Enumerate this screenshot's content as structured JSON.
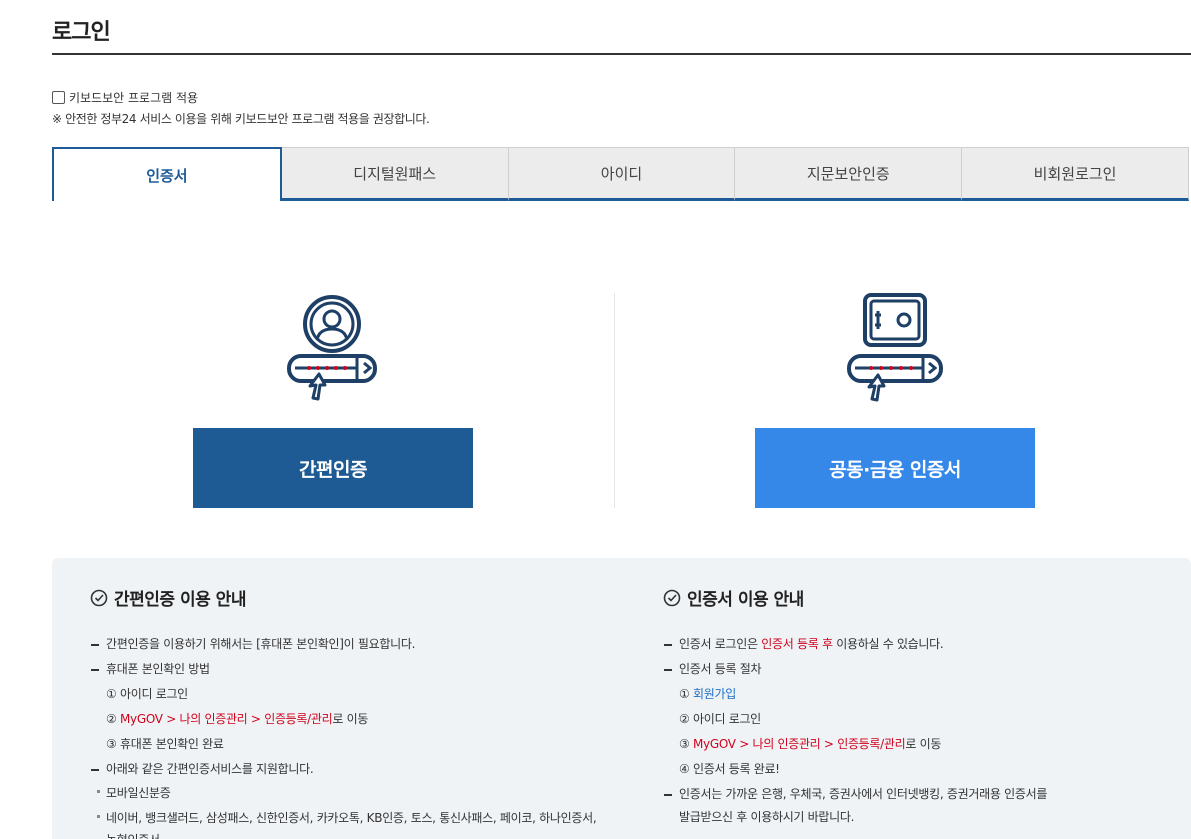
{
  "header": {
    "title": "로그인"
  },
  "keyboard_security": {
    "label": "키보드보안 프로그램 적용",
    "note": "※ 안전한 정부24 서비스 이용을 위해 키보드보안 프로그램 적용을 권장합니다."
  },
  "tabs": [
    {
      "label": "인증서",
      "active": true
    },
    {
      "label": "디지털원패스",
      "active": false
    },
    {
      "label": "아이디",
      "active": false
    },
    {
      "label": "지문보안인증",
      "active": false
    },
    {
      "label": "비회원로그인",
      "active": false
    }
  ],
  "login_options": {
    "simple_auth_button": "간편인증",
    "cert_button": "공동·금융 인증서"
  },
  "icons": {
    "simple_auth": "user-password-icon",
    "cert": "safe-password-icon",
    "check": "check-circle-icon"
  },
  "colors": {
    "accent": "#1e5b94",
    "cert_button": "#3587e8",
    "highlight": "#d0021b",
    "link": "#1e6fc6"
  },
  "simple_auth_guide": {
    "title": "간편인증 이용 안내",
    "item1": "간편인증을 이용하기 위해서는 [휴대폰 본인확인]이 필요합니다.",
    "item2": "휴대폰 본인확인 방법",
    "step1": "① 아이디 로그인",
    "step2_prefix": "② ",
    "step2_path": "MyGOV > 나의 인증관리 > 인증등록/관리",
    "step2_suffix": "로 이동",
    "step3": "③ 휴대폰 본인확인 완료",
    "item3": "아래와 같은 간편인증서비스를 지원합니다.",
    "service1": "모바일신분증",
    "service2": "네이버, 뱅크샐러드, 삼성패스, 신한인증서, 카카오톡, KB인증, 토스, 통신사패스, 페이코, 하나인증서,",
    "service2b": "농협인증서"
  },
  "cert_guide": {
    "title": "인증서 이용 안내",
    "item1_prefix": "인증서 로그인은 ",
    "item1_highlight": "인증서 등록 후",
    "item1_suffix": " 이용하실 수 있습니다.",
    "item2": "인증서 등록 절차",
    "step1_prefix": "① ",
    "step1_link": "회원가입",
    "step2": "② 아이디 로그인",
    "step3_prefix": "③ ",
    "step3_path": "MyGOV > 나의 인증관리 > 인증등록/관리",
    "step3_suffix": "로 이동",
    "step4": "④ 인증서 등록 완료!",
    "item3": "인증서는 가까운 은행, 우체국, 증권사에서 인터넷뱅킹, 증권거래용 인증서를",
    "item3b": "발급받으신 후 이용하시기 바랍니다."
  }
}
